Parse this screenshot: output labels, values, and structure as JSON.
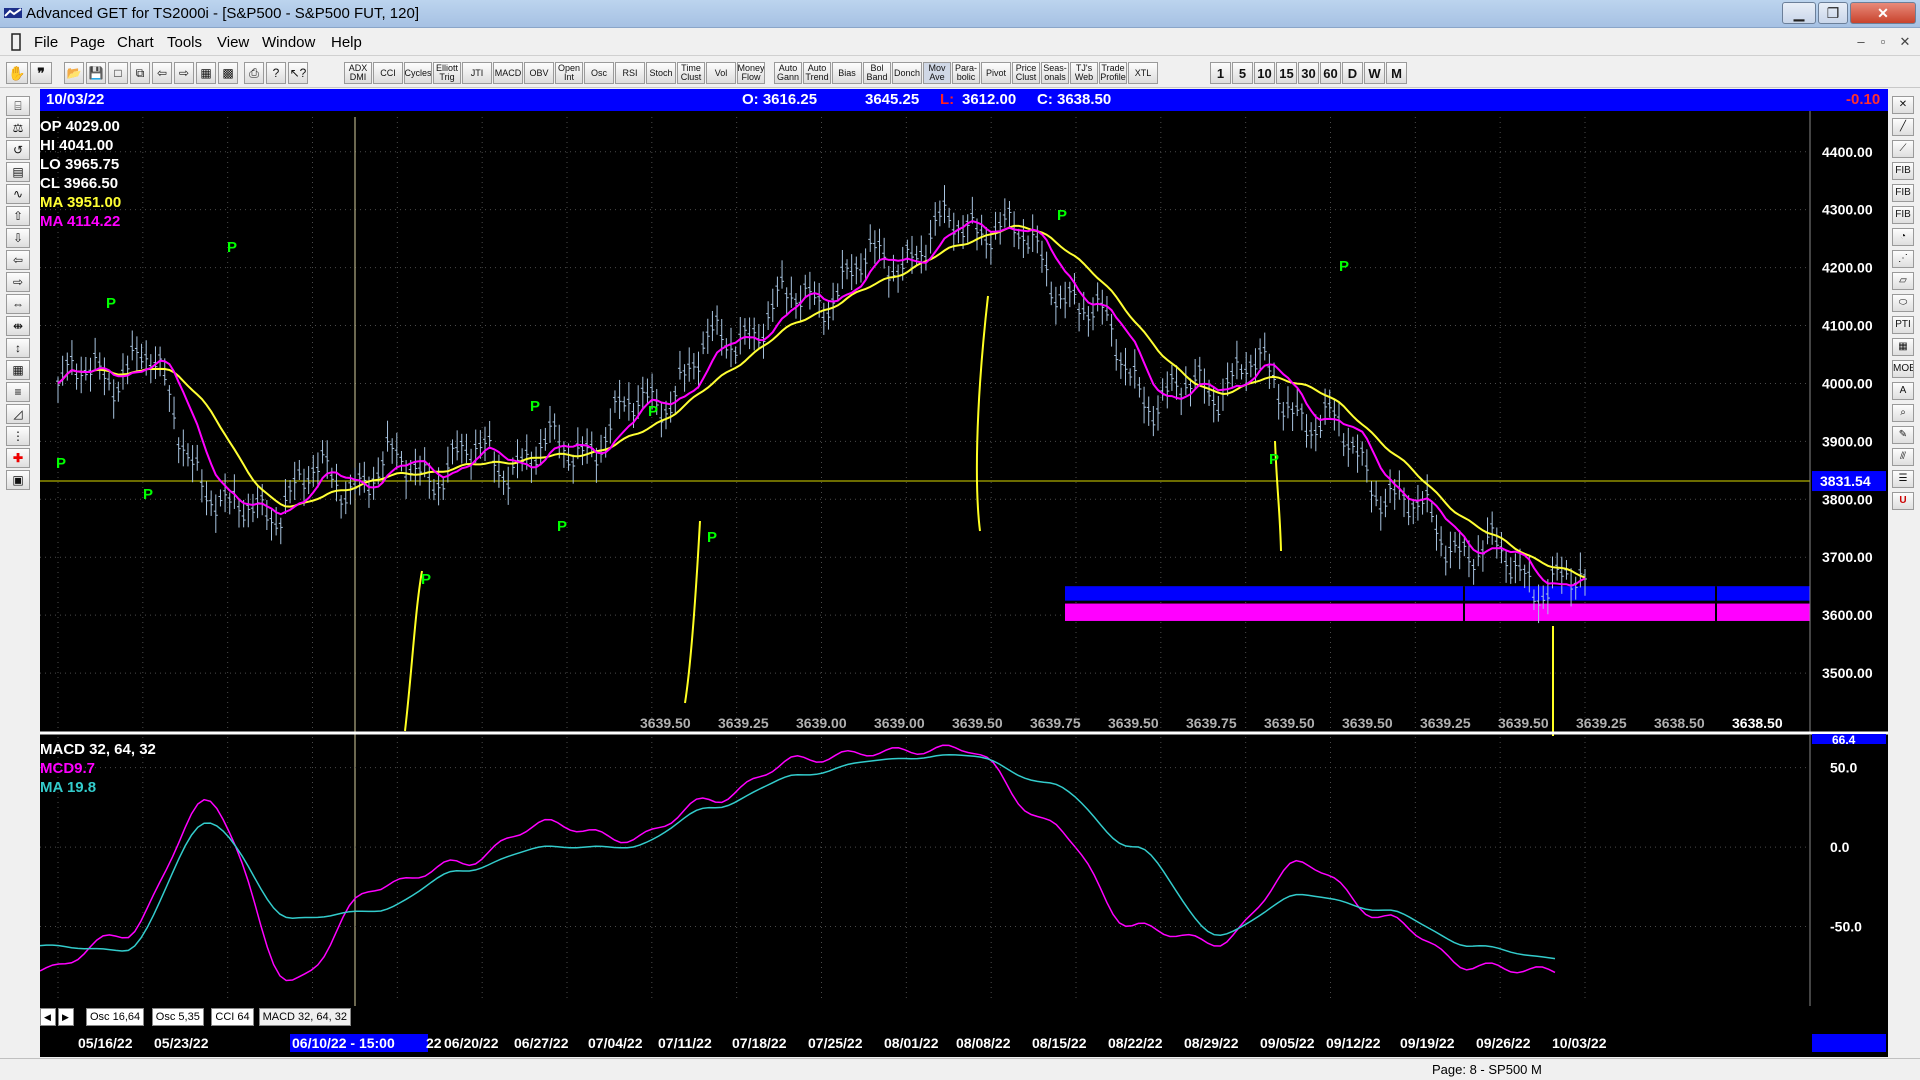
{
  "window": {
    "title": "Advanced GET for TS2000i - [S&P500 - S&P500 FUT, 120]",
    "minimize": "▁",
    "maximize": "❐",
    "close": "✕"
  },
  "menu": [
    "File",
    "Page",
    "Chart",
    "Tools",
    "View",
    "Window",
    "Help"
  ],
  "mdi": [
    "–",
    "▫",
    "✕"
  ],
  "toolbar": {
    "file_icons": [
      "open-icon",
      "save-icon",
      "new-icon",
      "copy-icon",
      "back-icon",
      "forward-icon",
      "layout-icon",
      "grid-icon",
      "print-icon",
      "question-icon",
      "help-pointer-icon"
    ],
    "studies": [
      "ADX DMI",
      "CCI",
      "Cycles",
      "Elliott Trig",
      "JTI",
      "MACD",
      "OBV",
      "Open Int",
      "Osc",
      "RSI",
      "Stoch",
      "Time Clust",
      "Vol",
      "Money Flow",
      "Auto Gann",
      "Auto Trend",
      "Bias",
      "Bol Band",
      "Donch",
      "Mov Ave",
      "Para- bolic",
      "Pivot",
      "Price Clust",
      "Seas- onals",
      "TJ's Web",
      "Trade Profile",
      "XTL"
    ],
    "intervals": [
      "1",
      "5",
      "10",
      "15",
      "30",
      "60",
      "D",
      "W",
      "M"
    ]
  },
  "infobar": {
    "date": "10/03/22",
    "open": "O: 3616.25",
    "high": "3645.25",
    "low_label": "L:",
    "low": "3612.00",
    "close": "C: 3638.50",
    "change": "-0.10"
  },
  "legend": {
    "op": "OP  4029.00",
    "hi": "HI   4041.00",
    "lo": "LO  3965.75",
    "cl": "CL  3966.50",
    "ma1": "MA  3951.00",
    "ma2": "MA  4114.22"
  },
  "macd_legend": {
    "title": "MACD 32, 64, 32",
    "mcd": "MCD9.7",
    "ma": "MA   19.8"
  },
  "colors": {
    "price": "#a8c4e0",
    "ma_fast": "#ffff33",
    "ma_slow": "#ff00ff",
    "pivot": "#00ff00",
    "macd": "#ff00ff",
    "macd_ma": "#33cccc",
    "zone_blue": "#0000ff",
    "zone_magenta": "#ff00ff"
  },
  "chart_data": [
    {
      "type": "line",
      "title": "S&P500 FUT, 120",
      "x": [
        "05/16/22",
        "05/23/22",
        "06/10/22",
        "06/20/22",
        "06/27/22",
        "07/04/22",
        "07/11/22",
        "07/18/22",
        "07/25/22",
        "08/01/22",
        "08/08/22",
        "08/15/22",
        "08/22/22",
        "08/29/22",
        "09/05/22",
        "09/12/22",
        "09/19/22",
        "09/26/22",
        "10/03/22"
      ],
      "series": [
        {
          "values": [
            3990,
            4050,
            3760,
            3830,
            3850,
            3870,
            3880,
            3970,
            4090,
            4160,
            4230,
            4290,
            4150,
            3960,
            4030,
            3920,
            3770,
            3690,
            3639
          ]
        }
      ],
      "ylim": [
        3400,
        4460
      ],
      "y_ticks": [
        "4400.00",
        "4300.00",
        "4200.00",
        "4100.00",
        "4000.00",
        "3900.00",
        "3800.00",
        "3700.00",
        "3600.00",
        "3500.00"
      ],
      "current_price_label": "3831.54",
      "horizontal_line": 3831.54,
      "zone_blue": [
        3625,
        3650
      ],
      "zone_magenta": [
        3590,
        3620
      ],
      "pivot_label": "P",
      "bottom_values": [
        "3639.50",
        "3639.25",
        "3639.00",
        "3639.00",
        "3639.50",
        "3639.75",
        "3639.50",
        "3639.75",
        "3639.50",
        "3639.50",
        "3639.25",
        "3639.50",
        "3639.25",
        "3638.50",
        "3638.50"
      ],
      "date_labels": [
        "05/16/22",
        "05/23/22",
        "06/10/22 - 15:00",
        "22",
        "06/20/22",
        "06/27/22",
        "07/04/22",
        "07/11/22",
        "07/18/22",
        "07/25/22",
        "08/01/22",
        "08/08/22",
        "08/15/22",
        "08/22/22",
        "08/29/22",
        "09/05/22",
        "09/12/22",
        "09/19/22",
        "09/26/22",
        "10/03/22"
      ]
    },
    {
      "type": "line",
      "title": "MACD 32, 64, 32",
      "x": [
        "05/16/22",
        "05/23/22",
        "06/10/22",
        "06/20/22",
        "06/27/22",
        "07/04/22",
        "07/11/22",
        "07/18/22",
        "07/25/22",
        "08/01/22",
        "08/08/22",
        "08/15/22",
        "08/22/22",
        "08/29/22",
        "09/05/22",
        "09/12/22",
        "09/19/22",
        "09/26/22",
        "10/03/22"
      ],
      "series": [
        {
          "name": "MCD",
          "values": [
            -78,
            -55,
            28,
            -85,
            -25,
            -10,
            15,
            5,
            30,
            55,
            60,
            62,
            15,
            -50,
            -60,
            -10,
            -45,
            -75,
            -78
          ]
        },
        {
          "name": "MA",
          "values": [
            -62,
            -65,
            15,
            -45,
            -40,
            -15,
            0,
            0,
            25,
            45,
            55,
            58,
            40,
            0,
            -55,
            -30,
            -40,
            -62,
            -70
          ]
        }
      ],
      "ylim": [
        -100,
        68
      ],
      "y_ticks": [
        "50.0",
        "0.0",
        "-50.0"
      ],
      "top_label": "66.4"
    }
  ],
  "osc_tabs": [
    "Osc 16,64",
    "Osc 5,35",
    "CCI 64",
    "MACD 32, 64, 32"
  ],
  "status": "Page: 8 - SP500 M"
}
